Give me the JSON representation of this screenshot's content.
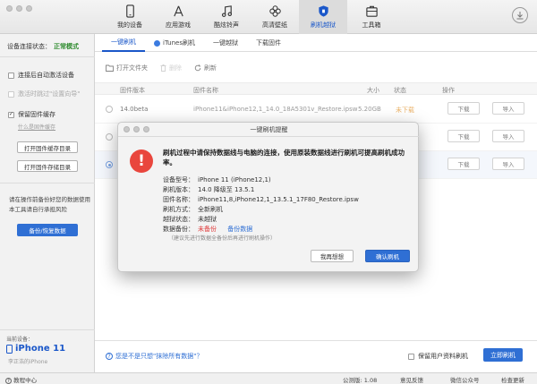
{
  "nav": {
    "items": [
      {
        "label": "我的设备",
        "icon": "phone-icon"
      },
      {
        "label": "应用游戏",
        "icon": "app-store-icon"
      },
      {
        "label": "酷炫铃声",
        "icon": "music-note-icon"
      },
      {
        "label": "高清壁纸",
        "icon": "flower-icon"
      },
      {
        "label": "刷机越狱",
        "icon": "shield-icon"
      },
      {
        "label": "工具箱",
        "icon": "toolbox-icon"
      }
    ],
    "active": "刷机越狱"
  },
  "sidebar": {
    "conn_label": "设备连接状态：",
    "conn_status": "正常模式",
    "options": [
      {
        "label": "连接后自动激活设备",
        "checked": false,
        "disabled": false
      },
      {
        "label": "激活时跳过\"设置向导\"",
        "checked": false,
        "disabled": true
      },
      {
        "label": "保留固件缓存",
        "checked": true,
        "disabled": false
      }
    ],
    "cache_link": "什么是固件缓存",
    "open_cache_dir": "打开固件缓存目录",
    "open_store_dir": "打开固件存储目录",
    "tip": "请在操作前备份好您的数据使用本工具请自行承担风险",
    "backup_button": "备份/恢复数据",
    "device_label": "当前设备：",
    "device_name": "iPhone 11",
    "device_sub": "李正浩的iPhone"
  },
  "tabs": [
    "一键刷机",
    "iTunes刷机",
    "一键越狱",
    "下载固件"
  ],
  "actions": {
    "open_folder": "打开文件夹",
    "delete": "删除",
    "refresh": "刷新"
  },
  "table": {
    "headers": {
      "version": "固件版本",
      "name": "固件名称",
      "size": "大小",
      "status": "状态",
      "ops": "操作"
    },
    "rows": [
      {
        "version": "14.0beta",
        "name": "iPhone11&iPhone12,1_14.0_18A5301v_Restore.ipsw",
        "size": "5.20GB",
        "status": "未下载",
        "download": "下载",
        "import": "导入"
      },
      {
        "version": "",
        "name": "",
        "size": "",
        "status": "",
        "download": "下载",
        "import": "导入"
      },
      {
        "version": "",
        "name": "",
        "size": "",
        "status": "",
        "download": "下载",
        "import": "导入"
      }
    ]
  },
  "bottom": {
    "help_text": "您是不是只想\"抹除所有数据\"？",
    "keep_data": "保留用户资料刷机",
    "flash_button": "立即刷机"
  },
  "statusbar": {
    "tutorial": "教程中心",
    "version": "公测版: 1.08",
    "feedback": "意见反馈",
    "wechat": "微信公众号",
    "update": "检查更新"
  },
  "modal": {
    "title": "一键刷机提醒",
    "heading": "刷机过程中请保持数据线与电脑的连接，使用原装数据线进行刷机可提高刷机成功率。",
    "device_model_label": "设备型号：",
    "device_model": "iPhone 11   (iPhone12,1)",
    "flash_version_label": "刷机版本：",
    "flash_version": "14.0 降级至 13.5.1",
    "firmware_name_label": "固件名称：",
    "firmware_name": "iPhone11,8,iPhone12,1_13.5.1_17F80_Restore.ipsw",
    "flash_mode_label": "刷机方式：",
    "flash_mode": "全新刷机",
    "jailbreak_label": "越狱状态：",
    "jailbreak": "未越狱",
    "backup_label": "数据备份：",
    "backup_status": "未备份",
    "backup_link": "备份数据",
    "hint": "（建议先进行数据全备份后再进行刷机操作）",
    "cancel": "我再想想",
    "confirm": "确认刷机"
  },
  "colors": {
    "accent": "#2f6fd4",
    "danger": "#e9463d",
    "ok": "#2c8a2c"
  }
}
